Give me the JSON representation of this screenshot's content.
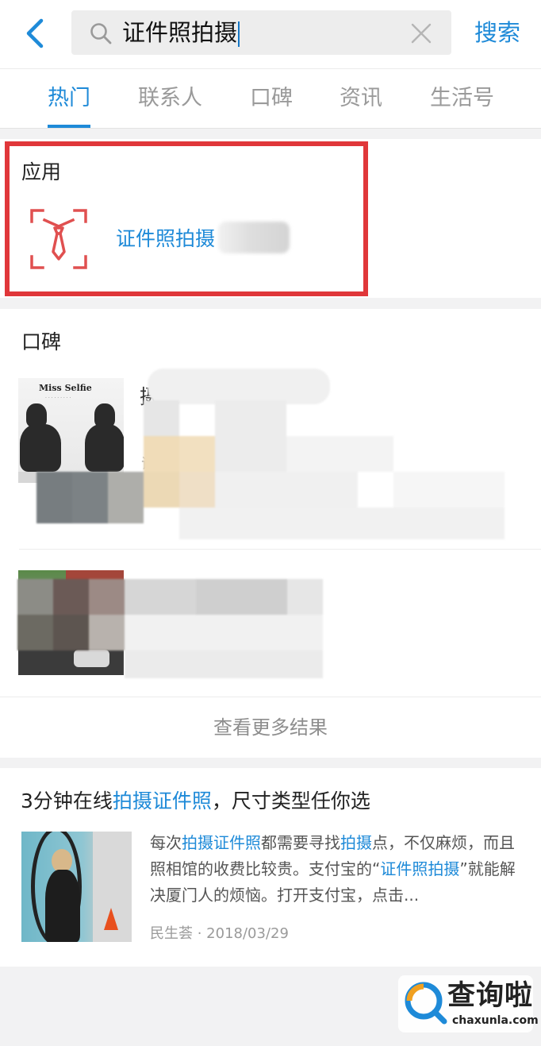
{
  "header": {
    "back_icon": "chevron-left-icon",
    "search_query": "证件照拍摄",
    "search_button_label": "搜索",
    "accent_color": "#1e8ad8"
  },
  "tabs": [
    {
      "label": "热门",
      "active": true
    },
    {
      "label": "联系人",
      "active": false
    },
    {
      "label": "口碑",
      "active": false
    },
    {
      "label": "资讯",
      "active": false
    },
    {
      "label": "生活号",
      "active": false
    }
  ],
  "apps_section": {
    "title": "应用",
    "app": {
      "name": "证件照拍摄",
      "icon": "tie-portrait-icon"
    },
    "highlight_color": "#e0373a"
  },
  "koubei_section": {
    "title": "口碑",
    "items": [
      {
        "thumb_title": "Miss Selfie",
        "name_visible": "摄",
        "desc_visible": "证件"
      },
      {
        "thumb_title": "",
        "name_visible": "",
        "desc_visible": ""
      }
    ],
    "more_results_label": "查看更多结果"
  },
  "article": {
    "title_prefix": "3分钟在线",
    "title_highlight_1": "拍摄证件照",
    "title_suffix": "，尺寸类型任你选",
    "desc_part_1": "每次",
    "desc_hl_1": "拍摄证件照",
    "desc_part_2": "都需要寻找",
    "desc_hl_2": "拍摄",
    "desc_part_3": "点，不仅麻烦，而且照相馆的收费比较贵。支付宝的“",
    "desc_hl_3": "证件照拍摄",
    "desc_part_4": "”就能解决厦门人的烦恼。打开支付宝，点击...",
    "source": "民生荟",
    "date": "2018/03/29"
  },
  "watermark": {
    "text": "查询啦",
    "url": "chaxunla.com"
  }
}
